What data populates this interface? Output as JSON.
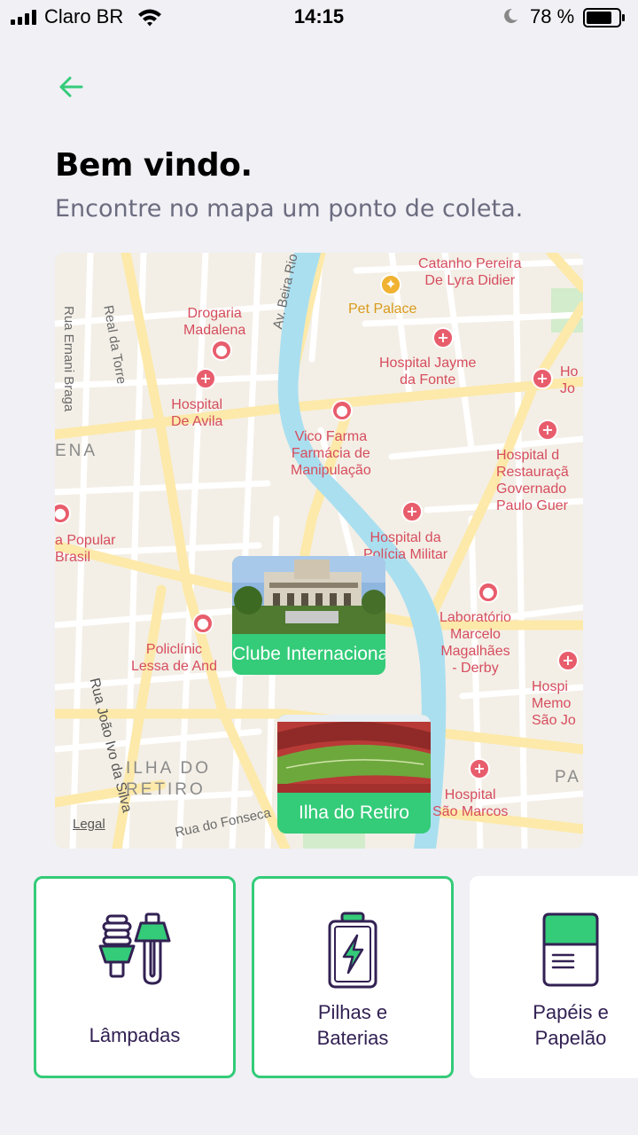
{
  "status_bar": {
    "carrier": "Claro BR",
    "time": "14:15",
    "battery": "78 %"
  },
  "header": {
    "back_icon": "arrow-left-icon",
    "title": "Bem vindo.",
    "subtitle": "Encontre no mapa um ponto de coleta."
  },
  "map": {
    "pois": {
      "catanho_1": "Catanho Pereira",
      "catanho_2": "De Lyra Didier",
      "pet_palace": "Pet Palace",
      "drogaria_1": "Drogaria",
      "drogaria_2": "Madalena",
      "jayme_1": "Hospital Jayme",
      "jayme_2": "da Fonte",
      "ho_1": "Ho",
      "ho_2": "Jo",
      "avila_1": "Hospital",
      "avila_2": "De Avila",
      "vico_1": "Vico Farma",
      "vico_2": "Farmácia de",
      "vico_3": "Manipulação",
      "rest_1": "Hospital d",
      "rest_2": "Restauraçã",
      "rest_3": "Governado",
      "rest_4": "Paulo Guer",
      "popular_1": "a Popular",
      "popular_2": "Brasil",
      "pm_1": "Hospital da",
      "pm_2": "Polícia Militar",
      "lab_1": "Laboratório",
      "lab_2": "Marcelo",
      "lab_3": "Magalhães",
      "lab_4": "- Derby",
      "poli_1": "Policlínic",
      "poli_2": "Lessa de And",
      "mem_1": "Hospi",
      "mem_2": "Memo",
      "mem_3": "São Jo",
      "marcos_1": "Hospital",
      "marcos_2": "São Marcos"
    },
    "streets": {
      "real_torre": "Real da Torre",
      "beira_rio": "Av. Beira Rio",
      "ernani_braga": "Rua Ernani Braga",
      "joao_ivo": "Rua João Ivo da Silva",
      "fonseca": "Rua do Fonseca"
    },
    "districts": {
      "ena": "ENA",
      "ilha_1": "ILHA DO",
      "ilha_2": "RETIRO",
      "pa": "PA"
    },
    "legal": "Legal",
    "markers": [
      {
        "name": "Clube Internacional"
      },
      {
        "name": "Ilha do Retiro"
      }
    ]
  },
  "items": [
    {
      "label_1": "Lâmpadas",
      "label_2": "",
      "icon": "lamp-icon",
      "selected": true
    },
    {
      "label_1": "Pilhas e",
      "label_2": "Baterias",
      "icon": "battery-icon",
      "selected": true
    },
    {
      "label_1": "Papéis e",
      "label_2": "Papelão",
      "icon": "paper-icon",
      "selected": false
    }
  ],
  "colors": {
    "accent": "#34cb79",
    "title": "#322153",
    "background": "#f0f0f5",
    "subtitle": "#6c6c80"
  }
}
